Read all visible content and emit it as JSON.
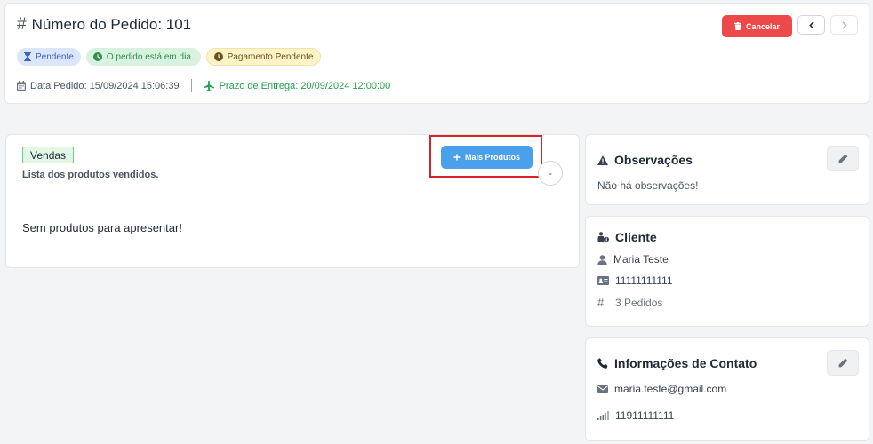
{
  "header": {
    "title": "Número do Pedido: 101",
    "badges": {
      "pending": "Pendente",
      "on_time": "O pedido está em dia.",
      "payment": "Pagamento Pendente"
    },
    "order_date": "Data Pedido: 15/09/2024 15:06:39",
    "delivery_date": "Prazo de Entrega: 20/09/2024 12:00:00",
    "cancel_label": "Cancelar",
    "icons": [
      "hash-icon",
      "hourglass-icon",
      "clock-icon",
      "calendar-icon",
      "plane-icon",
      "trash-icon",
      "chevron-left-icon",
      "chevron-right-icon"
    ]
  },
  "vendas": {
    "tag": "Vendas",
    "subtitle": "Lista dos produtos vendidos.",
    "more_products_label": "Mais Produtos",
    "collapse_label": "-",
    "empty_message": "Sem produtos para apresentar!"
  },
  "observacoes": {
    "title": "Observações",
    "text": "Não há observações!"
  },
  "cliente": {
    "title": "Cliente",
    "name": "Maria Teste",
    "document": "11111111111",
    "orders": "3 Pedidos"
  },
  "contato": {
    "title": "Informações de Contato",
    "email": "maria.teste@gmail.com",
    "phone": "11911111111"
  },
  "colors": {
    "danger": "#ec4a4a",
    "primary": "#4aa0ea",
    "success": "#22a24a",
    "highlight": "#d8232a"
  }
}
